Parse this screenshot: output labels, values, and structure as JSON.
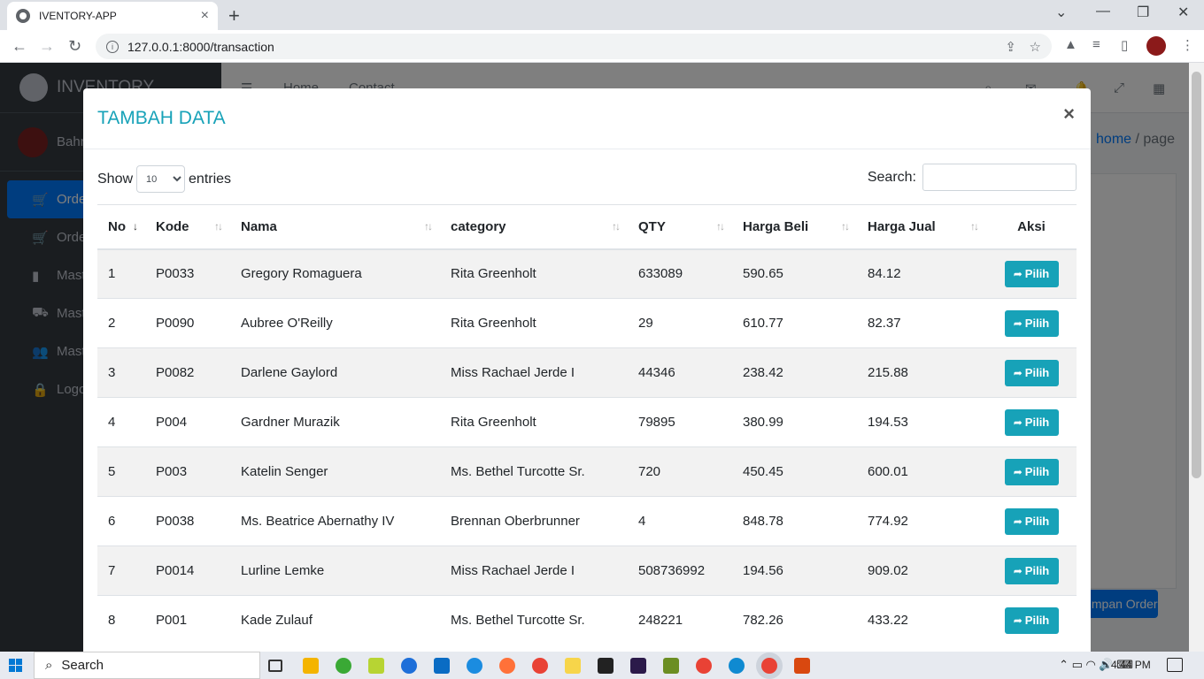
{
  "browser": {
    "tab_title": "IVENTORY-APP",
    "tab_close": "×",
    "new_tab": "+",
    "url": "127.0.0.1:8000/transaction"
  },
  "app": {
    "brand": "INVENTORY",
    "user_name": "Bahri",
    "topnav": [
      "Home",
      "Contact"
    ],
    "breadcrumb": {
      "home": "home",
      "sep": "/",
      "current": "page"
    },
    "sidebar": [
      {
        "label": "Order",
        "icon": "cart-icon",
        "active": true
      },
      {
        "label": "Order",
        "icon": "cart-icon",
        "active": false
      },
      {
        "label": "Master",
        "icon": "book-icon",
        "active": false
      },
      {
        "label": "Master",
        "icon": "truck-icon",
        "active": false
      },
      {
        "label": "Master",
        "icon": "users-icon",
        "active": false
      },
      {
        "label": "Logout",
        "icon": "lock-icon",
        "active": false
      }
    ],
    "save_order_label": "Simpan Order"
  },
  "modal": {
    "title": "TAMBAH DATA",
    "close": "×",
    "show_label": "Show",
    "entries_value": "10",
    "entries_label": "entries",
    "search_label": "Search:",
    "search_value": "",
    "columns": [
      "No",
      "Kode",
      "Nama",
      "category",
      "QTY",
      "Harga Beli",
      "Harga Jual",
      "Aksi"
    ],
    "action_label": "Pilih",
    "rows": [
      {
        "no": "1",
        "kode": "P0033",
        "nama": "Gregory Romaguera",
        "category": "Rita Greenholt",
        "qty": "633089",
        "beli": "590.65",
        "jual": "84.12"
      },
      {
        "no": "2",
        "kode": "P0090",
        "nama": "Aubree O'Reilly",
        "category": "Rita Greenholt",
        "qty": "29",
        "beli": "610.77",
        "jual": "82.37"
      },
      {
        "no": "3",
        "kode": "P0082",
        "nama": "Darlene Gaylord",
        "category": "Miss Rachael Jerde I",
        "qty": "44346",
        "beli": "238.42",
        "jual": "215.88"
      },
      {
        "no": "4",
        "kode": "P004",
        "nama": "Gardner Murazik",
        "category": "Rita Greenholt",
        "qty": "79895",
        "beli": "380.99",
        "jual": "194.53"
      },
      {
        "no": "5",
        "kode": "P003",
        "nama": "Katelin Senger",
        "category": "Ms. Bethel Turcotte Sr.",
        "qty": "720",
        "beli": "450.45",
        "jual": "600.01"
      },
      {
        "no": "6",
        "kode": "P0038",
        "nama": "Ms. Beatrice Abernathy IV",
        "category": "Brennan Oberbrunner",
        "qty": "4",
        "beli": "848.78",
        "jual": "774.92"
      },
      {
        "no": "7",
        "kode": "P0014",
        "nama": "Lurline Lemke",
        "category": "Miss Rachael Jerde I",
        "qty": "508736992",
        "beli": "194.56",
        "jual": "909.02"
      },
      {
        "no": "8",
        "kode": "P001",
        "nama": "Kade Zulauf",
        "category": "Ms. Bethel Turcotte Sr.",
        "qty": "248221",
        "beli": "782.26",
        "jual": "433.22"
      }
    ]
  },
  "taskbar": {
    "search_placeholder": "Search",
    "time": "4:44 PM"
  },
  "colors": {
    "accent": "#17a2b8",
    "primary": "#007bff",
    "sidebar": "#343a40"
  }
}
